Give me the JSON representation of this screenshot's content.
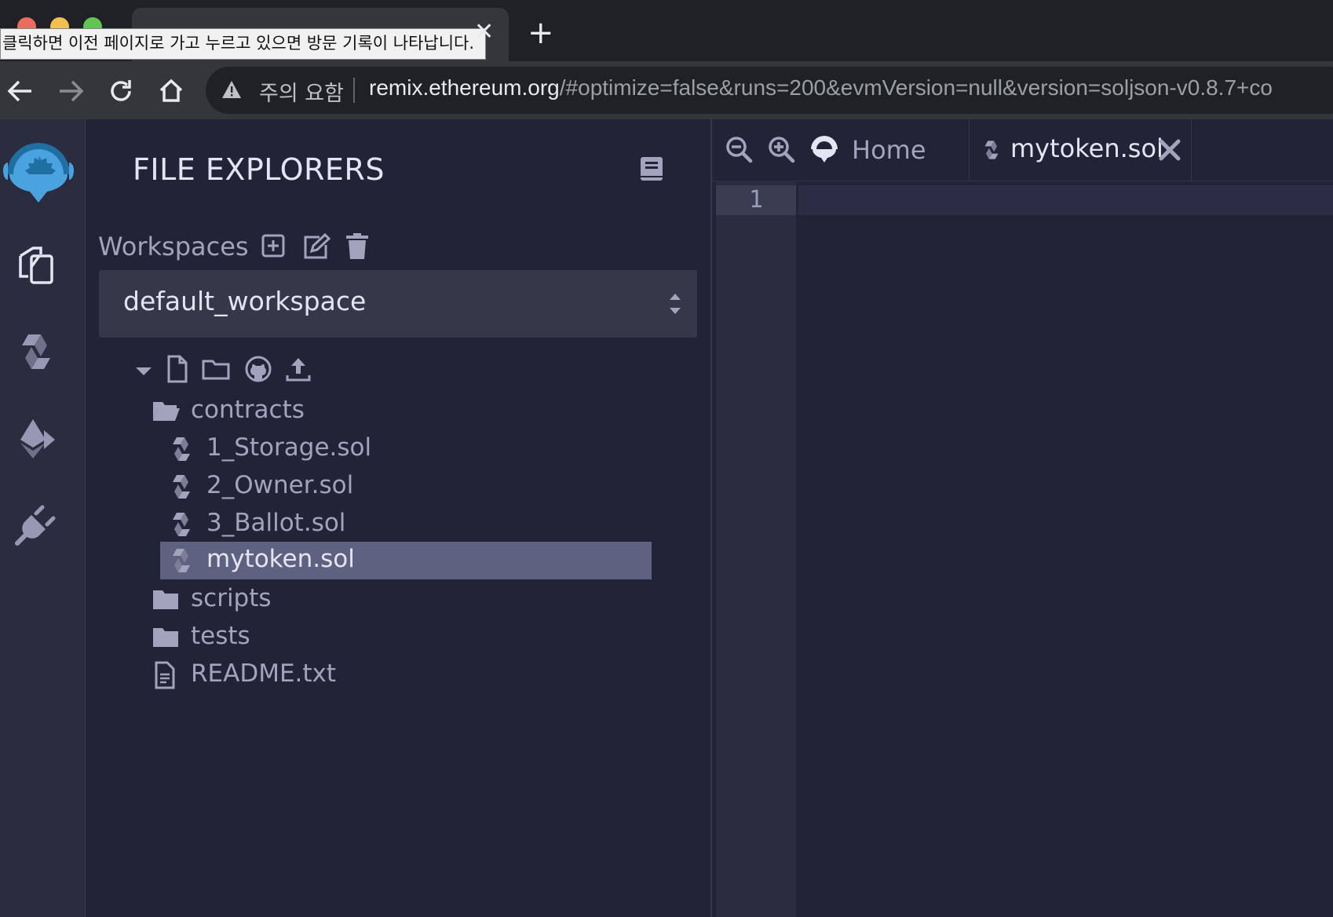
{
  "browser": {
    "tooltip": "클릭하면 이전 페이지로 가고 누르고 있으면 방문 기록이 나타납니다.",
    "close_tab_glyph": "✕",
    "new_tab_glyph": "+",
    "address": {
      "security_label": "주의 요함",
      "url_host": "remix.ethereum.org",
      "url_rest": "/#optimize=false&runs=200&evmVersion=null&version=soljson-v0.8.7+co"
    }
  },
  "icon_panel": {
    "items": [
      "remix-logo-icon",
      "file-explorer-icon",
      "solidity-compiler-icon",
      "deploy-run-icon",
      "plugin-manager-icon"
    ]
  },
  "explorer": {
    "title": "FILE EXPLORERS",
    "workspaces_label": "Workspaces",
    "workspace_selected": "default_workspace",
    "tree": [
      {
        "type": "folder-open",
        "name": "contracts"
      },
      {
        "type": "sol",
        "name": "1_Storage.sol"
      },
      {
        "type": "sol",
        "name": "2_Owner.sol"
      },
      {
        "type": "sol",
        "name": "3_Ballot.sol"
      },
      {
        "type": "sol",
        "name": "mytoken.sol",
        "selected": true
      },
      {
        "type": "folder",
        "name": "scripts"
      },
      {
        "type": "folder",
        "name": "tests"
      },
      {
        "type": "file",
        "name": "README.txt"
      }
    ]
  },
  "editor": {
    "tabs": [
      {
        "label": "Home"
      },
      {
        "label": "mytoken.sol",
        "active": true
      }
    ],
    "line_numbers": [
      "1"
    ]
  },
  "colors": {
    "accent": "#4aa3df",
    "background": "#222336",
    "panel": "#2a2c3f",
    "selected": "#5f6180"
  }
}
